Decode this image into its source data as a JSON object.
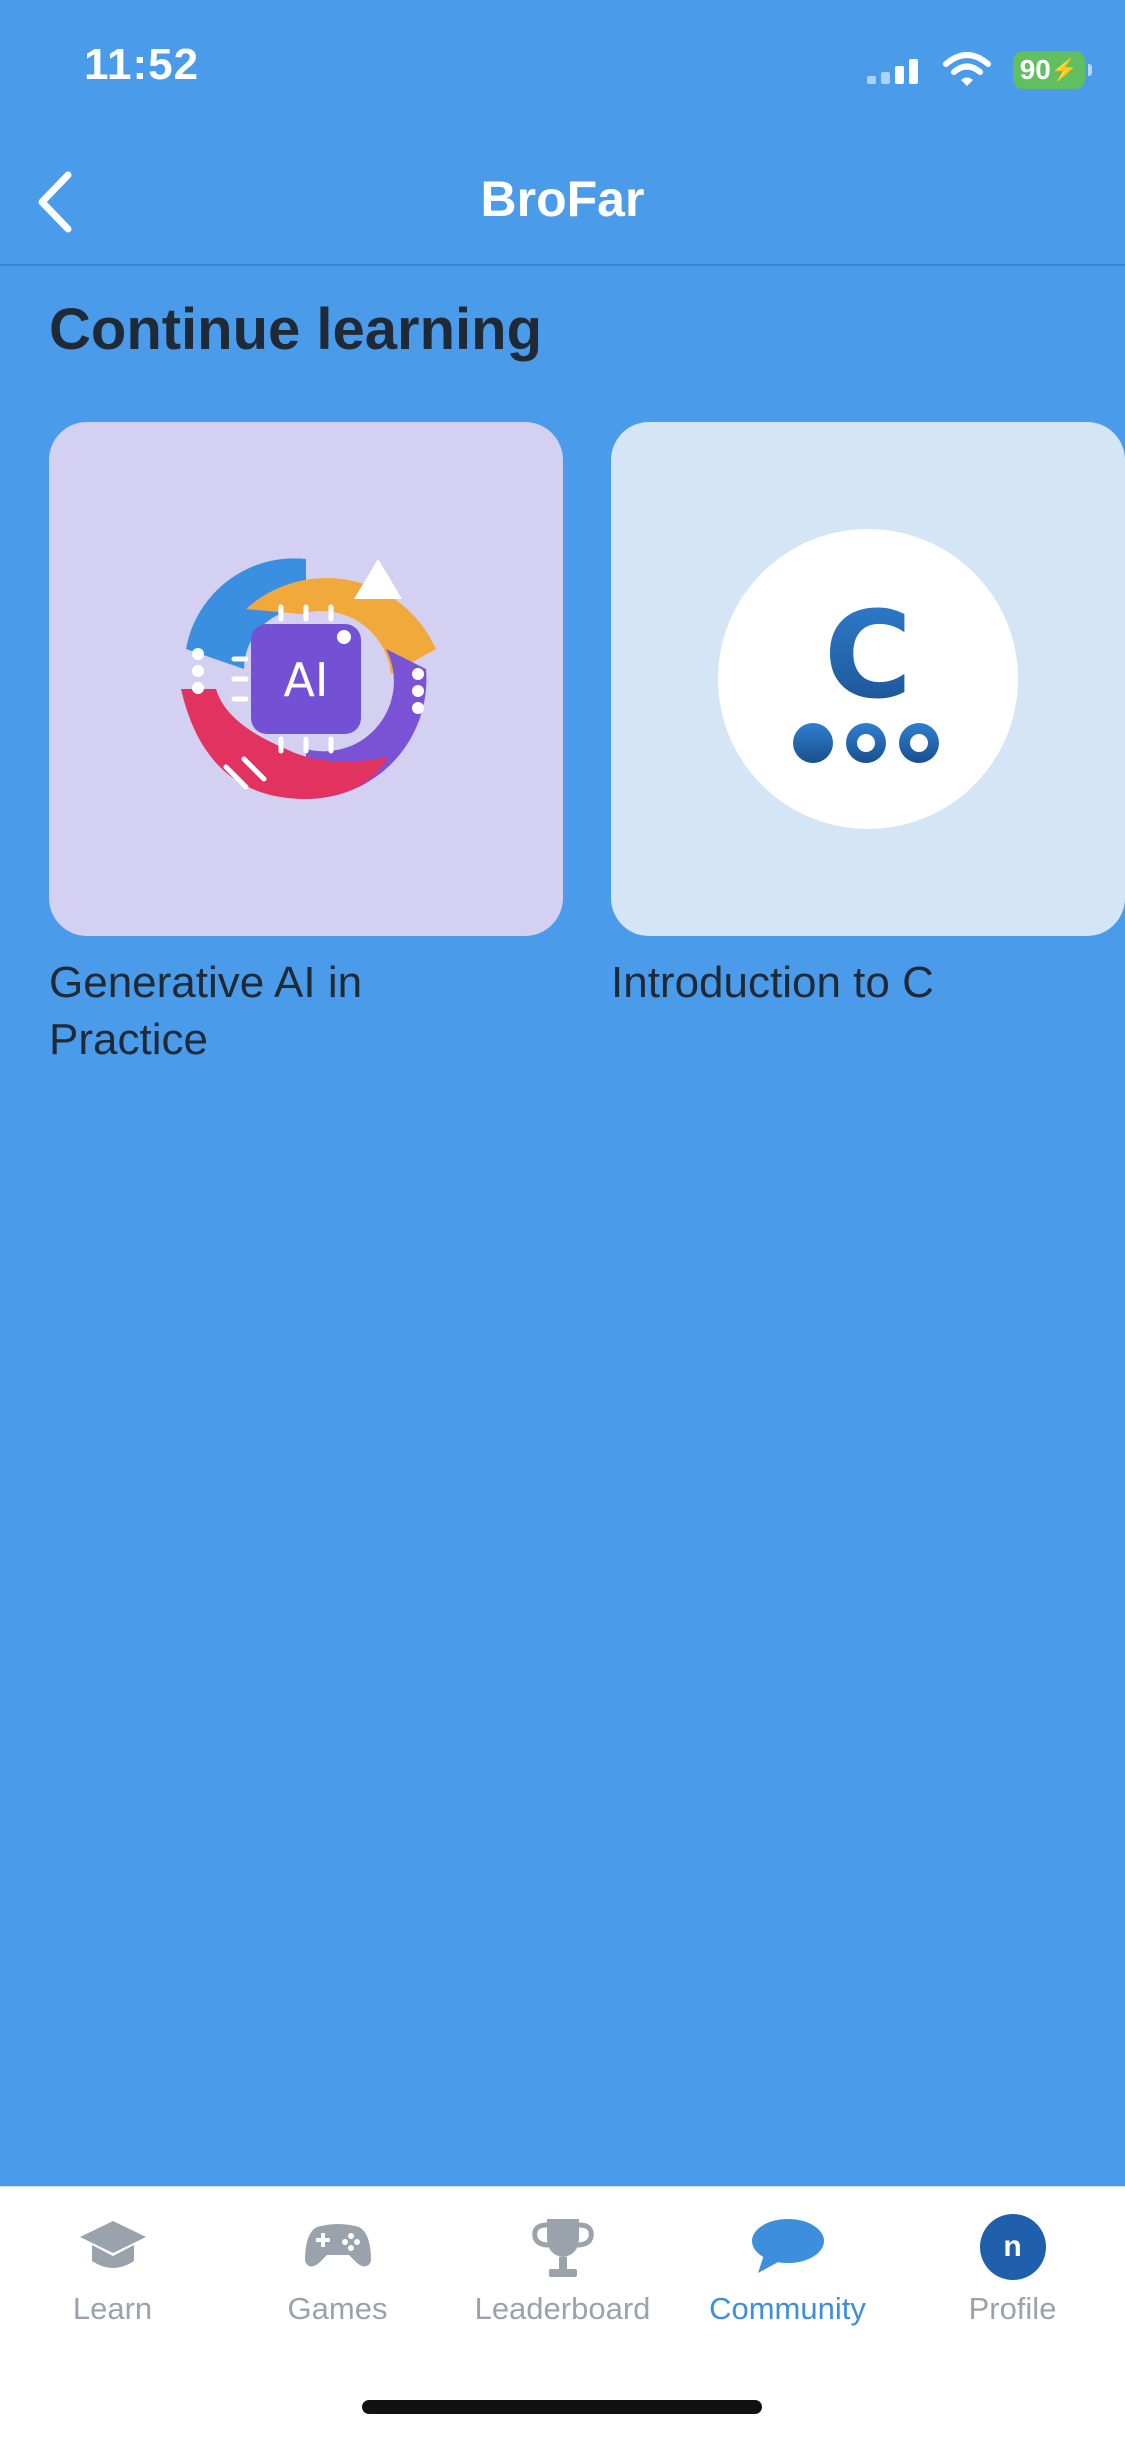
{
  "status_bar": {
    "time": "11:52",
    "battery_level": "90"
  },
  "nav": {
    "title": "BroFar",
    "back_icon": "chevron-left-icon"
  },
  "section": {
    "title": "Continue learning"
  },
  "courses": [
    {
      "title": "Generative AI in Practice",
      "icon": "generative-ai-icon",
      "icon_text": "AI"
    },
    {
      "title": "Introduction to C",
      "icon": "c-language-icon",
      "icon_text": "C"
    }
  ],
  "tabs": [
    {
      "label": "Learn",
      "icon": "graduation-cap-icon",
      "active": false
    },
    {
      "label": "Games",
      "icon": "gamepad-icon",
      "active": false
    },
    {
      "label": "Leaderboard",
      "icon": "trophy-icon",
      "active": false
    },
    {
      "label": "Community",
      "icon": "chat-bubble-icon",
      "active": true
    },
    {
      "label": "Profile",
      "icon": "avatar-icon",
      "avatar_letter": "n",
      "active": false
    }
  ],
  "colors": {
    "background": "#4a9ceb",
    "tab_active": "#3d8fdd",
    "tab_inactive": "#9aa2ab",
    "card_ai_bg": "#d3d0f2",
    "card_c_bg": "#d4e5f5"
  }
}
